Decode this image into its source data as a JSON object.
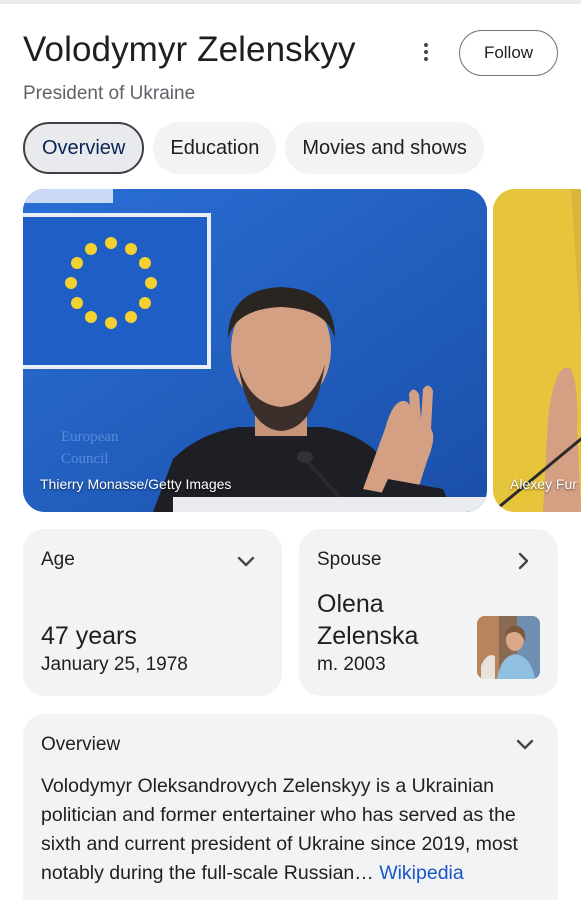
{
  "header": {
    "name": "Volodymyr Zelenskyy",
    "subtitle": "President of Ukraine",
    "follow_label": "Follow"
  },
  "tabs": [
    {
      "label": "Overview",
      "active": true
    },
    {
      "label": "Education",
      "active": false
    },
    {
      "label": "Movies and shows",
      "active": false
    }
  ],
  "images": [
    {
      "caption": "Thierry Monasse/Getty Images",
      "backdrop_text": [
        "European",
        "Council"
      ]
    },
    {
      "caption": "Alexey Fur"
    }
  ],
  "age_card": {
    "label": "Age",
    "value": "47 years",
    "detail": "January 25, 1978"
  },
  "spouse_card": {
    "label": "Spouse",
    "name_line1": "Olena",
    "name_line2": "Zelenska",
    "detail": "m. 2003"
  },
  "overview_card": {
    "label": "Overview",
    "text": "Volodymyr Oleksandrovych Zelenskyy is a Ukrainian politician and former entertainer who has served as the sixth and current president of Ukraine since 2019, most notably during the full-scale Russian…",
    "source_link": "Wikipedia"
  },
  "colors": {
    "flag_blue": "#1f5ec4",
    "star_yellow": "#f5d130",
    "link_blue": "#1a56c9",
    "card_bg": "#f1f3f4"
  }
}
